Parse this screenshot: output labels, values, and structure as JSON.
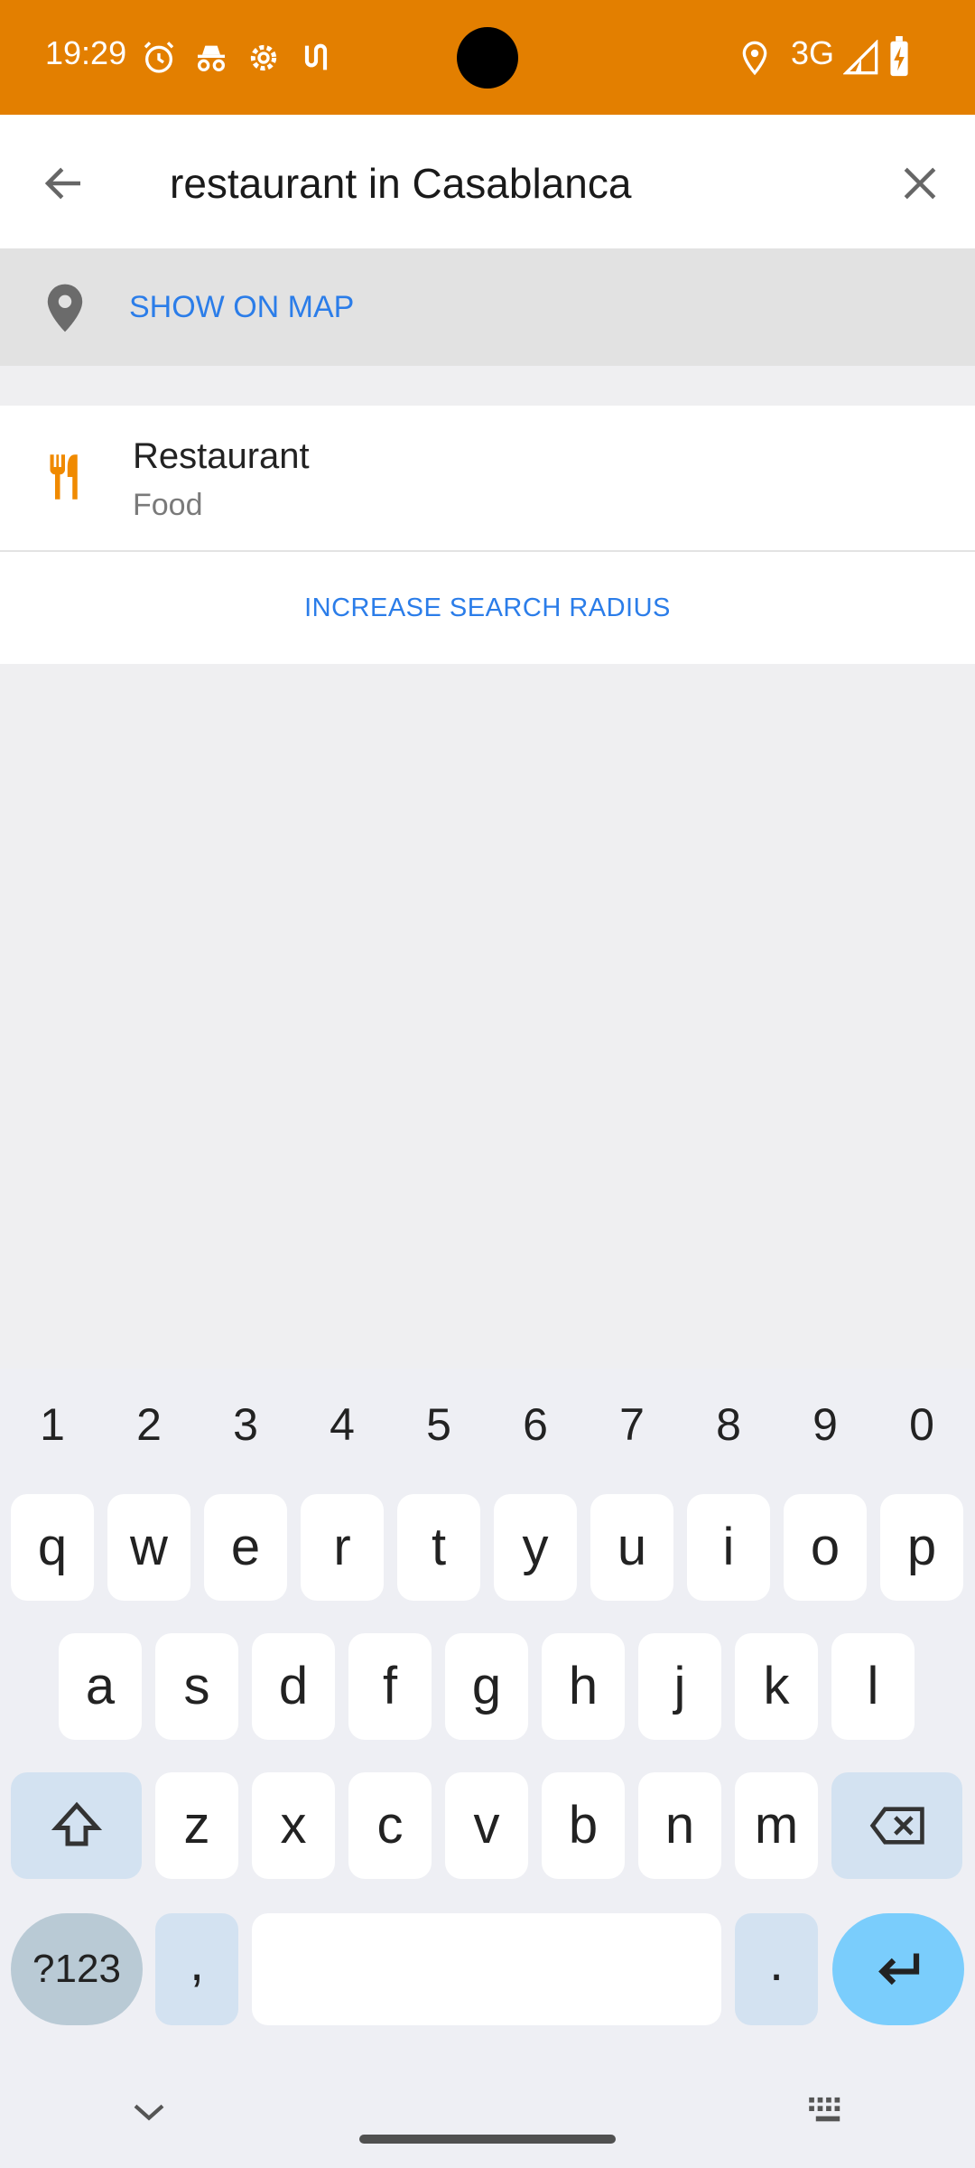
{
  "status_bar": {
    "time": "19:29",
    "network": "3G",
    "icons_left": [
      "alarm-icon",
      "incognito-icon",
      "settings-icon",
      "usb-icon"
    ],
    "icons_right": [
      "location-icon",
      "signal-icon",
      "battery-charging-icon"
    ]
  },
  "search": {
    "query": "restaurant in Casablanca",
    "back_icon": "arrow-back-icon",
    "clear_icon": "close-icon"
  },
  "show_on_map": {
    "label": "SHOW ON MAP",
    "icon": "map-pin-icon"
  },
  "results": [
    {
      "title": "Restaurant",
      "subtitle": "Food",
      "icon": "restaurant-icon"
    }
  ],
  "increase_radius": {
    "label": "INCREASE SEARCH RADIUS"
  },
  "keyboard": {
    "numbers": [
      "1",
      "2",
      "3",
      "4",
      "5",
      "6",
      "7",
      "8",
      "9",
      "0"
    ],
    "row1": [
      "q",
      "w",
      "e",
      "r",
      "t",
      "y",
      "u",
      "i",
      "o",
      "p"
    ],
    "row2": [
      "a",
      "s",
      "d",
      "f",
      "g",
      "h",
      "j",
      "k",
      "l"
    ],
    "row3": [
      "z",
      "x",
      "c",
      "v",
      "b",
      "n",
      "m"
    ],
    "symbols_label": "?123",
    "comma": ",",
    "period": ".",
    "accent_color": "#7acdfc",
    "collapse_icon": "chevron-down-icon",
    "keyboard_icon": "keyboard-icon"
  },
  "colors": {
    "status_bar": "#e37f00",
    "link": "#2b7de9",
    "restaurant_icon": "#f08a00"
  }
}
